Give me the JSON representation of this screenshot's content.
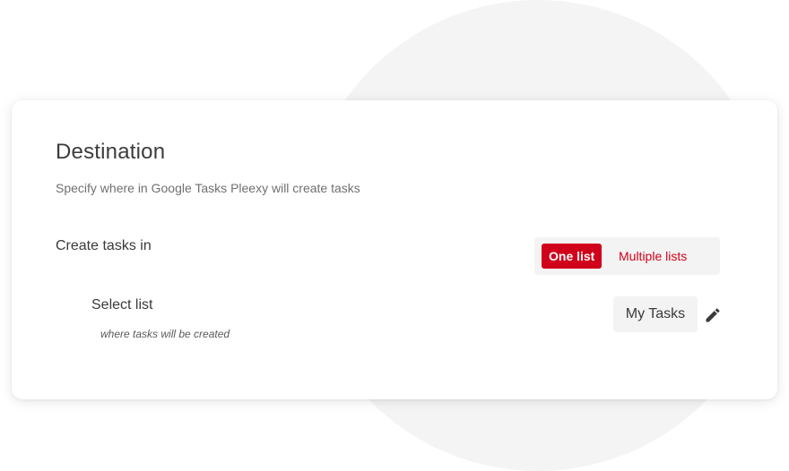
{
  "destination": {
    "title": "Destination",
    "subtitle": "Specify where in Google Tasks Pleexy will create tasks"
  },
  "create_tasks": {
    "label": "Create tasks in",
    "options": [
      {
        "label": "One list",
        "selected": true
      },
      {
        "label": "Multiple lists",
        "selected": false
      }
    ]
  },
  "select_list": {
    "label": "Select list",
    "sublabel": "where tasks will be created",
    "value": "My Tasks",
    "edit_icon": "pencil-icon"
  },
  "colors": {
    "accent": "#d0021b",
    "chip_background": "#f3f3f3",
    "background_circle": "#f4f4f4"
  }
}
